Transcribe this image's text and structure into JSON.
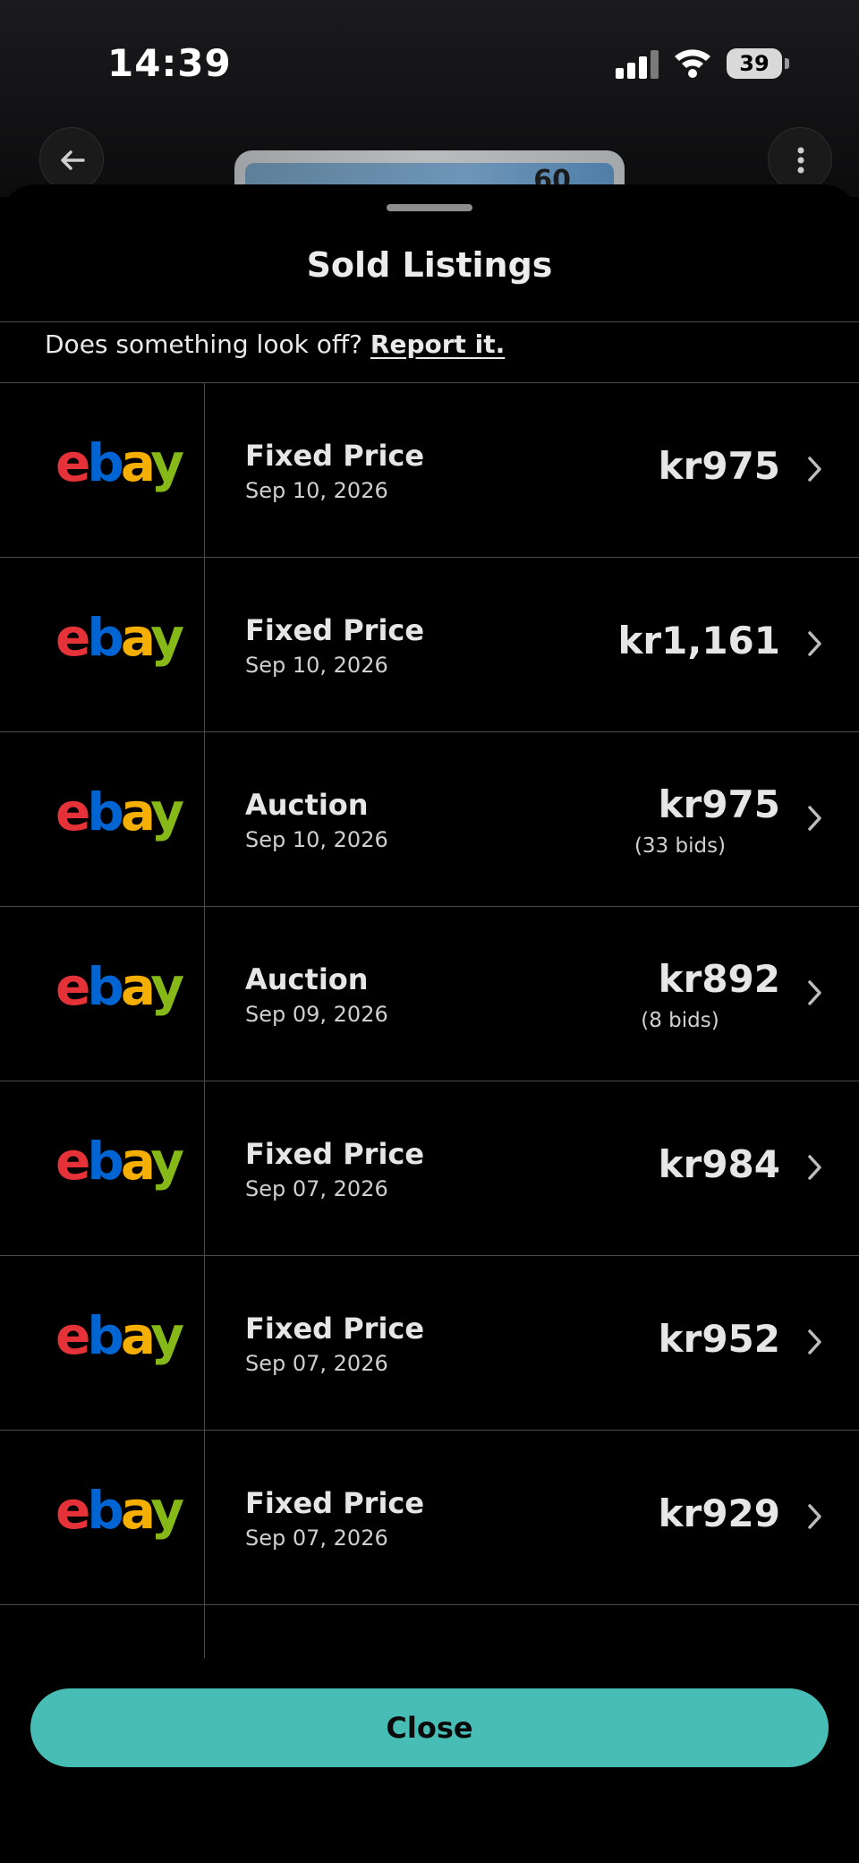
{
  "status_bar": {
    "time": "14:39",
    "battery": "39"
  },
  "card_peek": {
    "hp": "60"
  },
  "sheet": {
    "title": "Sold Listings",
    "report_prompt": "Does something look off?",
    "report_link": "Report it."
  },
  "listings": [
    {
      "source": "ebay",
      "type": "Fixed Price",
      "date": "Sep 10, 2026",
      "price": "kr975",
      "bids": ""
    },
    {
      "source": "ebay",
      "type": "Fixed Price",
      "date": "Sep 10, 2026",
      "price": "kr1,161",
      "bids": ""
    },
    {
      "source": "ebay",
      "type": "Auction",
      "date": "Sep 10, 2026",
      "price": "kr975",
      "bids": "(33 bids)"
    },
    {
      "source": "ebay",
      "type": "Auction",
      "date": "Sep 09, 2026",
      "price": "kr892",
      "bids": "(8 bids)"
    },
    {
      "source": "ebay",
      "type": "Fixed Price",
      "date": "Sep 07, 2026",
      "price": "kr984",
      "bids": ""
    },
    {
      "source": "ebay",
      "type": "Fixed Price",
      "date": "Sep 07, 2026",
      "price": "kr952",
      "bids": ""
    },
    {
      "source": "ebay",
      "type": "Fixed Price",
      "date": "Sep 07, 2026",
      "price": "kr929",
      "bids": ""
    }
  ],
  "close_button": {
    "label": "Close",
    "color": "#48bdb5"
  },
  "icons": {
    "back": "arrow-left-icon",
    "more": "more-vertical-icon",
    "row": "chevron-right-icon"
  }
}
